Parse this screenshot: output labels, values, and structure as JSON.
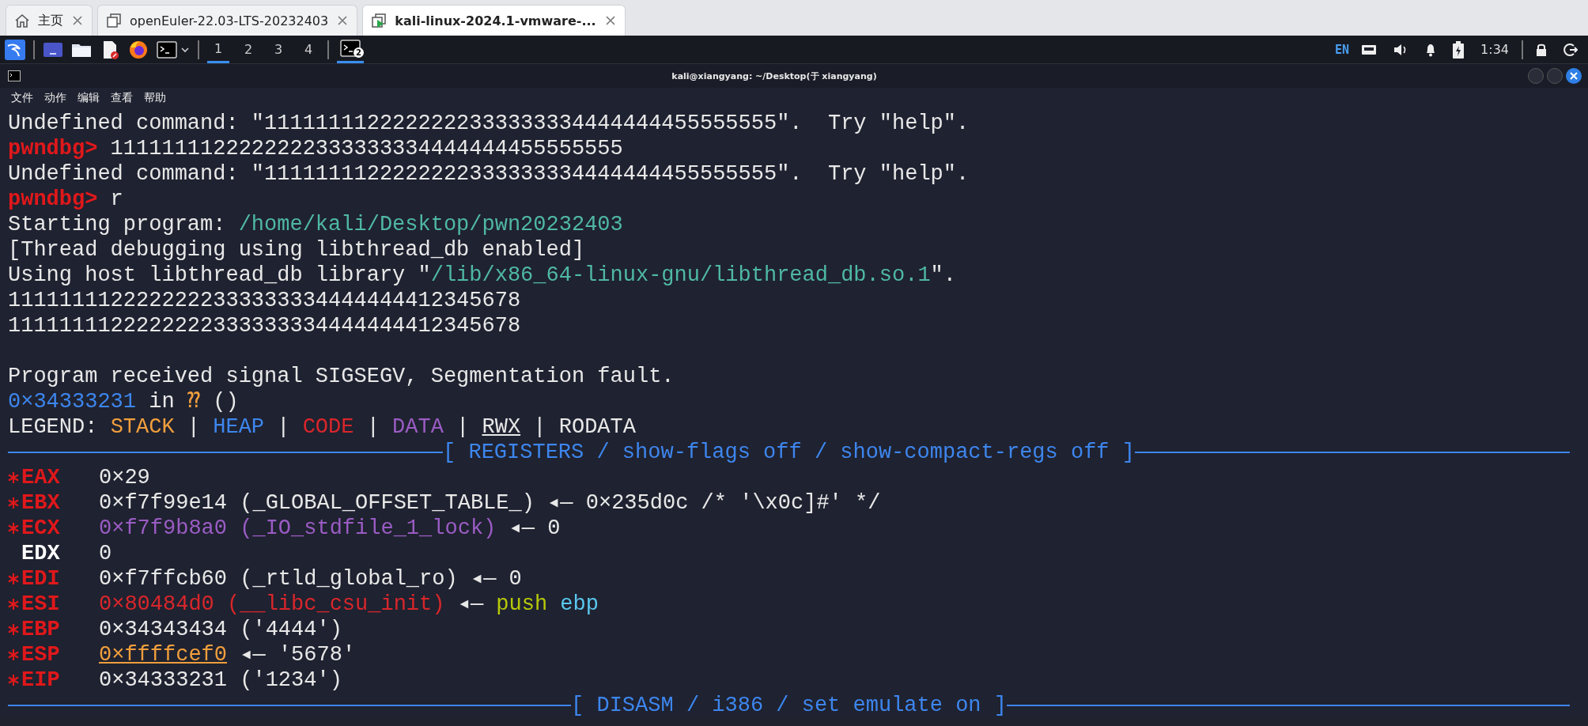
{
  "browser": {
    "tabs": [
      {
        "label": "主页",
        "selected": false
      },
      {
        "label": "openEuler-22.03-LTS-20232403",
        "selected": false
      },
      {
        "label": "kali-linux-2024.1-vmware-...",
        "selected": true
      }
    ]
  },
  "panel": {
    "launchers": [
      {
        "kind": "kali"
      },
      {
        "kind": "desktop"
      },
      {
        "kind": "files"
      },
      {
        "kind": "editor"
      },
      {
        "kind": "browser"
      },
      {
        "kind": "terminal"
      }
    ],
    "workspaces": [
      {
        "label": "1",
        "selected": true
      },
      {
        "label": "2",
        "selected": false
      },
      {
        "label": "3",
        "selected": false
      },
      {
        "label": "4",
        "selected": false
      }
    ],
    "task": {
      "badge": "2",
      "selected": true
    },
    "tray": {
      "language": "EN",
      "clock": "1:34"
    }
  },
  "terminal": {
    "title": "kali@xiangyang: ~/Desktop(于 xiangyang)",
    "menu": [
      "文件",
      "动作",
      "编辑",
      "查看",
      "帮助"
    ],
    "lines": [
      {
        "kind": "text",
        "segments": [
          {
            "text": "Undefined command: \"1111111122222222333333334444444455555555\".  Try \"help\".",
            "kind": "plain"
          }
        ]
      },
      {
        "kind": "text",
        "segments": [
          {
            "text": "pwndbg>",
            "kind": "prompt"
          },
          {
            "text": " 1111111122222222333333334444444455555555",
            "kind": "plain"
          }
        ]
      },
      {
        "kind": "text",
        "segments": [
          {
            "text": "Undefined command: \"1111111122222222333333334444444455555555\".  Try \"help\".",
            "kind": "plain"
          }
        ]
      },
      {
        "kind": "text",
        "segments": [
          {
            "text": "pwndbg>",
            "kind": "prompt"
          },
          {
            "text": " r",
            "kind": "plain"
          }
        ]
      },
      {
        "kind": "text",
        "segments": [
          {
            "text": "Starting program: ",
            "kind": "plain"
          },
          {
            "text": "/home/kali/Desktop/pwn20232403",
            "kind": "path"
          }
        ]
      },
      {
        "kind": "text",
        "segments": [
          {
            "text": "[Thread debugging using libthread_db enabled]",
            "kind": "plain"
          }
        ]
      },
      {
        "kind": "text",
        "segments": [
          {
            "text": "Using host libthread_db library \"",
            "kind": "plain"
          },
          {
            "text": "/lib/x86_64-linux-gnu/libthread_db.so.1",
            "kind": "path"
          },
          {
            "text": "\".",
            "kind": "plain"
          }
        ]
      },
      {
        "kind": "text",
        "segments": [
          {
            "text": "1111111122222222333333334444444412345678",
            "kind": "plain"
          }
        ]
      },
      {
        "kind": "text",
        "segments": [
          {
            "text": "1111111122222222333333334444444412345678",
            "kind": "plain"
          }
        ]
      },
      {
        "kind": "blank"
      },
      {
        "kind": "text",
        "segments": [
          {
            "text": "Program received signal SIGSEGV, Segmentation fault.",
            "kind": "plain"
          }
        ]
      },
      {
        "kind": "text",
        "segments": [
          {
            "text": "0×34333231",
            "kind": "heap"
          },
          {
            "text": " in ",
            "kind": "plain"
          },
          {
            "text": "⁇",
            "kind": "stack"
          },
          {
            "text": " ()",
            "kind": "plain"
          }
        ]
      },
      {
        "kind": "text",
        "segments": [
          {
            "text": "LEGEND: ",
            "kind": "plain"
          },
          {
            "text": "STACK",
            "kind": "stack"
          },
          {
            "text": " | ",
            "kind": "plain"
          },
          {
            "text": "HEAP",
            "kind": "heap"
          },
          {
            "text": " | ",
            "kind": "plain"
          },
          {
            "text": "CODE",
            "kind": "code"
          },
          {
            "text": " | ",
            "kind": "plain"
          },
          {
            "text": "DATA",
            "kind": "data"
          },
          {
            "text": " | ",
            "kind": "plain"
          },
          {
            "text": "RWX",
            "kind": "rwx"
          },
          {
            "text": " | ",
            "kind": "plain"
          },
          {
            "text": "RODATA",
            "kind": "plain"
          }
        ]
      },
      {
        "kind": "rule",
        "title": "[ REGISTERS / show-flags off / show-compact-regs off ]"
      },
      {
        "kind": "register",
        "name": "EAX",
        "changed": true,
        "segments": [
          {
            "text": "0×29",
            "kind": "plain"
          }
        ]
      },
      {
        "kind": "register",
        "name": "EBX",
        "changed": true,
        "segments": [
          {
            "text": "0×f7f99e14 (_GLOBAL_OFFSET_TABLE_) ◂— 0×235d0c /* '\\x0c]#' */",
            "kind": "plain"
          }
        ]
      },
      {
        "kind": "register",
        "name": "ECX",
        "changed": true,
        "segments": [
          {
            "text": "0×f7f9b8a0 (_IO_stdfile_1_lock)",
            "kind": "data"
          },
          {
            "text": " ◂— 0",
            "kind": "plain"
          }
        ]
      },
      {
        "kind": "register",
        "name": "EDX",
        "changed": false,
        "segments": [
          {
            "text": "0",
            "kind": "plain"
          }
        ]
      },
      {
        "kind": "register",
        "name": "EDI",
        "changed": true,
        "segments": [
          {
            "text": "0×f7ffcb60 (_rtld_global_ro) ◂— 0",
            "kind": "plain"
          }
        ]
      },
      {
        "kind": "register",
        "name": "ESI",
        "changed": true,
        "segments": [
          {
            "text": "0×80484d0 (__libc_csu_init)",
            "kind": "code"
          },
          {
            "text": " ◂— ",
            "kind": "plain"
          },
          {
            "text": "push",
            "kind": "instr"
          },
          {
            "text": " ebp",
            "kind": "operand"
          }
        ]
      },
      {
        "kind": "register",
        "name": "EBP",
        "changed": true,
        "segments": [
          {
            "text": "0×34343434 ('4444')",
            "kind": "plain"
          }
        ]
      },
      {
        "kind": "register",
        "name": "ESP",
        "changed": true,
        "segments": [
          {
            "text": "0×ffffcef0",
            "kind": "stack-ptr"
          },
          {
            "text": " ◂— '5678'",
            "kind": "plain"
          }
        ]
      },
      {
        "kind": "register",
        "name": "EIP",
        "changed": true,
        "segments": [
          {
            "text": "0×34333231 ('1234')",
            "kind": "plain"
          }
        ]
      },
      {
        "kind": "rule",
        "title": "[ DISASM / i386 / set emulate on ]"
      }
    ]
  }
}
